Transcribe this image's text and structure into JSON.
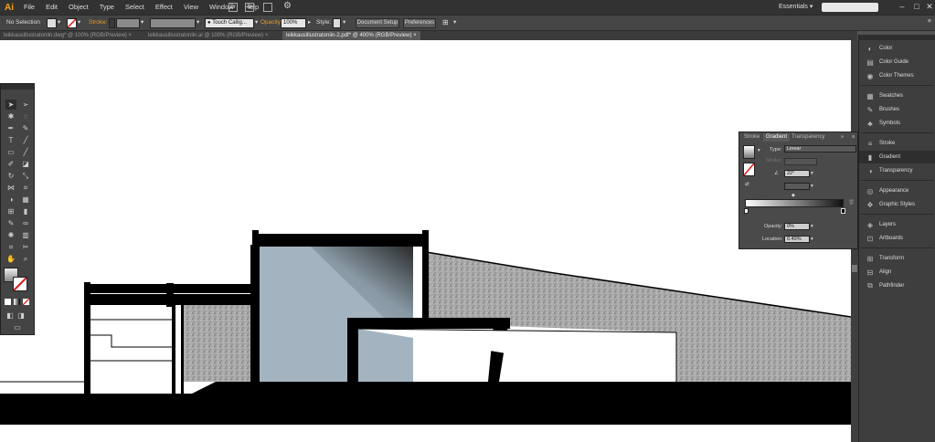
{
  "app": {
    "logo": "Ai"
  },
  "menu": [
    "File",
    "Edit",
    "Object",
    "Type",
    "Select",
    "Effect",
    "View",
    "Window",
    "Help"
  ],
  "workspace": {
    "label": "Essentials ▾"
  },
  "search": {
    "placeholder": ""
  },
  "control_bar": {
    "selection": "No Selection",
    "stroke_label": "Stroke:",
    "brush_name": "Touch Callig...",
    "opacity_label": "Opacity:",
    "opacity_value": "100%",
    "style_label": "Style:",
    "document_setup": "Document Setup",
    "preferences": "Preferences"
  },
  "tabs": [
    {
      "label": "leikkausillustratoniin.dwg* @ 100% (RGB/Preview)",
      "active": false
    },
    {
      "label": "leikkausillustratoniin.ai @ 100% (RGB/Preview)",
      "active": false
    },
    {
      "label": "leikkausillustratoniin-2.pdf* @ 400% (RGB/Preview)",
      "active": true
    }
  ],
  "dock": {
    "items": [
      {
        "label": "Color",
        "icon": "color-icon"
      },
      {
        "label": "Color Guide",
        "icon": "color-guide-icon"
      },
      {
        "label": "Color Themes",
        "icon": "color-themes-icon"
      },
      {
        "label": "Swatches",
        "icon": "swatches-icon"
      },
      {
        "label": "Brushes",
        "icon": "brushes-icon"
      },
      {
        "label": "Symbols",
        "icon": "symbols-icon"
      },
      {
        "label": "Stroke",
        "icon": "stroke-icon"
      },
      {
        "label": "Gradient",
        "icon": "gradient-icon"
      },
      {
        "label": "Transparency",
        "icon": "transparency-icon"
      },
      {
        "label": "Appearance",
        "icon": "appearance-icon"
      },
      {
        "label": "Graphic Styles",
        "icon": "graphic-styles-icon"
      },
      {
        "label": "Layers",
        "icon": "layers-icon"
      },
      {
        "label": "Artboards",
        "icon": "artboards-icon"
      },
      {
        "label": "Transform",
        "icon": "transform-icon"
      },
      {
        "label": "Align",
        "icon": "align-icon"
      },
      {
        "label": "Pathfinder",
        "icon": "pathfinder-icon"
      }
    ]
  },
  "gradient_panel": {
    "tabs": [
      "Stroke",
      "Gradient",
      "Transparency"
    ],
    "type_label": "Type:",
    "type_value": "Linear",
    "stroke_label": "Stroke:",
    "angle_value": "22°",
    "opacity_label": "Opacity:",
    "opacity_value": "0%",
    "location_label": "Location:",
    "location_value": "0.49%"
  }
}
